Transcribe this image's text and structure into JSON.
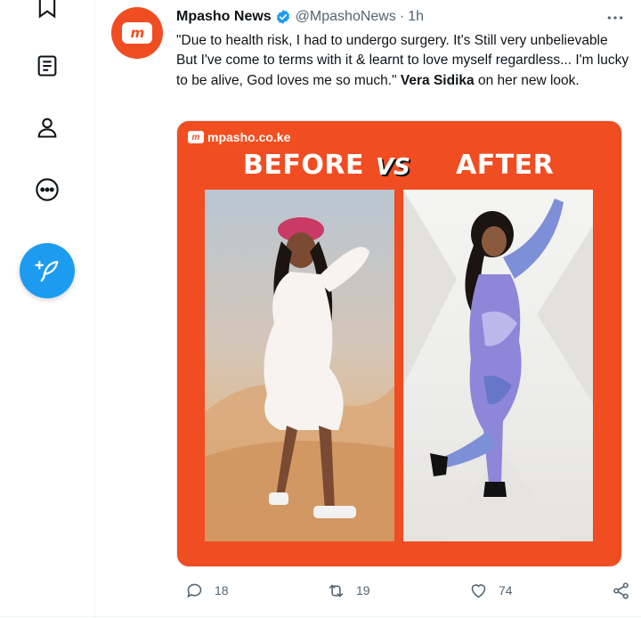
{
  "nav": {
    "items": [
      {
        "name": "bookmarks",
        "icon": "bookmark-icon"
      },
      {
        "name": "lists",
        "icon": "list-icon"
      },
      {
        "name": "profile",
        "icon": "person-icon"
      },
      {
        "name": "more",
        "icon": "more-circle-icon"
      }
    ],
    "compose_icon": "compose-feather-icon"
  },
  "tweet": {
    "author_name": "Mpasho News",
    "handle": "@MpashoNews",
    "separator": "·",
    "time": "1h",
    "avatar_text": "m",
    "text_quote": "\"Due to health risk, I had to undergo surgery. It's Still very unbelievable But I've come to terms with it & learnt to love myself regardless... I'm lucky to be alive, God loves me so much.\"",
    "text_bold": "Vera Sidika",
    "text_tail": "on her new look.",
    "media": {
      "brand": "mpasho.co.ke",
      "brand_badge": "m",
      "before_label": "BEFORE",
      "vs_label": "VS",
      "after_label": "AFTER"
    },
    "actions": {
      "replies": "18",
      "retweets": "19",
      "likes": "74"
    }
  },
  "colors": {
    "brand_orange": "#f04d22",
    "twitter_blue": "#1d9bf0",
    "muted": "#536471"
  }
}
